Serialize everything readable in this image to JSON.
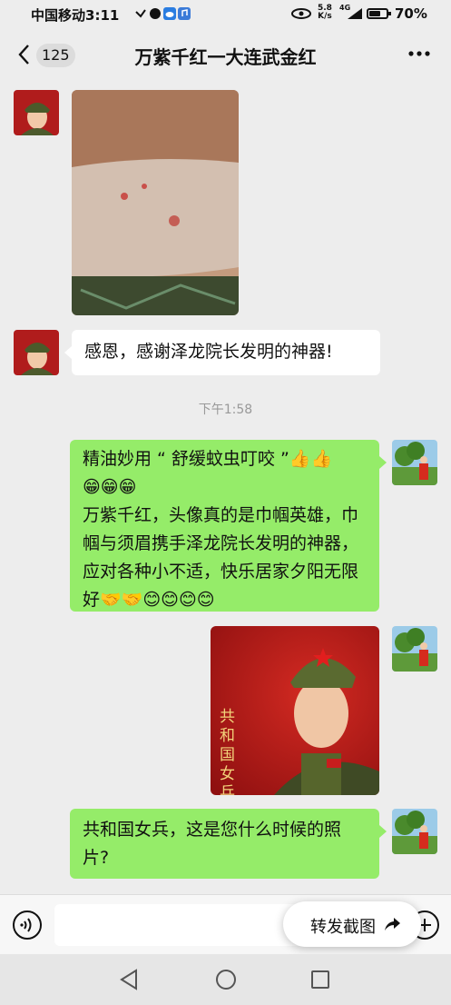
{
  "status_bar": {
    "carrier": "中国移动",
    "time": "3:11",
    "speed_value": "5.8",
    "speed_unit": "K/s",
    "network": "4G",
    "battery": "70%"
  },
  "header": {
    "back_count": "125",
    "title": "万紫千红一大连武金红",
    "back_icon": "chevron-left-icon",
    "more_icon": "more-dots-icon"
  },
  "messages": [
    {
      "side": "left",
      "type": "image",
      "content": "arm with bug bite marks photo"
    },
    {
      "side": "left",
      "type": "text",
      "text": "感恩，感谢泽龙院长发明的神器!"
    },
    {
      "side": "center",
      "type": "timestamp",
      "text": "下午1:58"
    },
    {
      "side": "right",
      "type": "text",
      "line1": "精油妙用 “ 舒缓蚊虫叮咬 ”",
      "line2": "",
      "body": "万紫千红，头像真的是巾帼英雄，巾帼与须眉携手泽龙院长发明的神器，应对各种小不适，快乐居家夕阳无限好",
      "emoji_thumbs": "👍👍",
      "emoji_grins": "😁😁😁",
      "emoji_end": "🤝🤝😊😊😊😊"
    },
    {
      "side": "right",
      "type": "image",
      "caption": "共和国女兵"
    },
    {
      "side": "right",
      "type": "text",
      "text": "共和国女兵，这是您什么时候的照片?"
    }
  ],
  "input_bar": {
    "voice_icon": "voice-icon",
    "plus_icon": "plus-icon",
    "forward_label": "转发截图",
    "forward_icon": "share-arrow-icon"
  },
  "colors": {
    "background": "#ededed",
    "bubble_green": "#95ec69",
    "bubble_white": "#ffffff"
  }
}
